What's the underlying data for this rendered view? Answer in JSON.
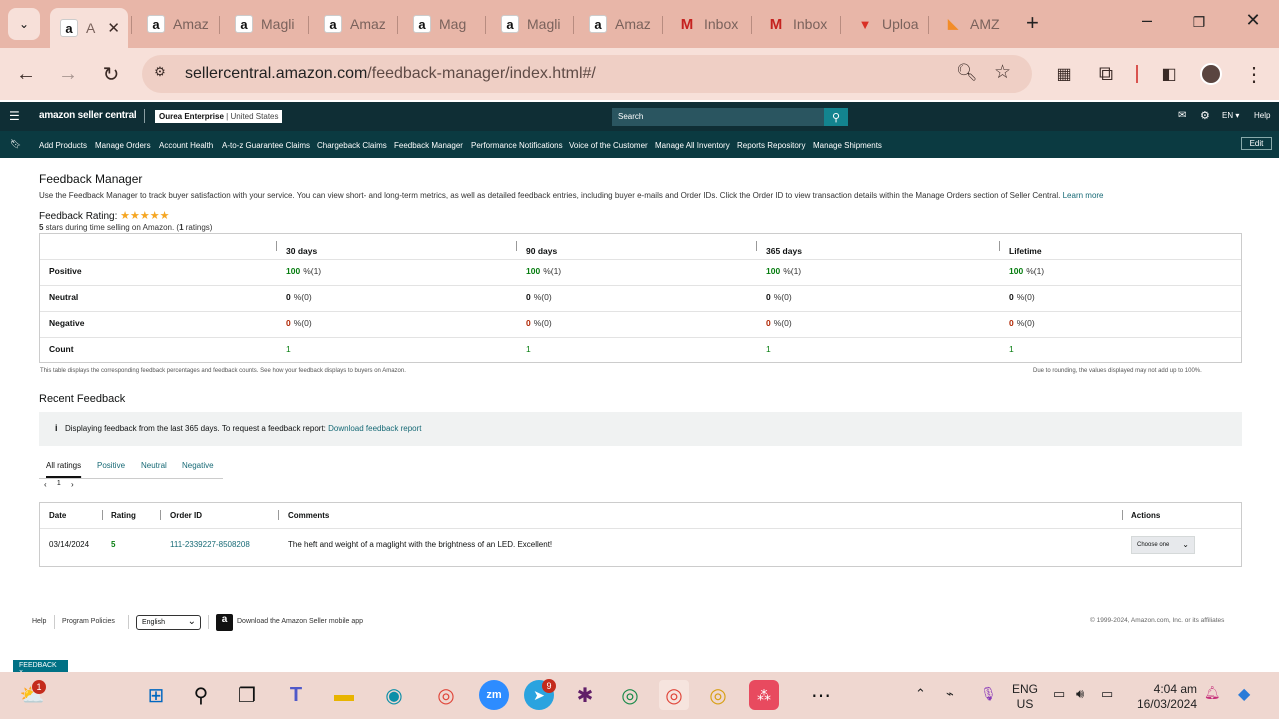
{
  "browser": {
    "tabs": [
      {
        "label": "A",
        "favicon": "amazon-icon",
        "active": true
      },
      {
        "label": "Amaz",
        "favicon": "amazon-icon"
      },
      {
        "label": "Magli",
        "favicon": "amazon-icon"
      },
      {
        "label": "Amaz",
        "favicon": "amazon-icon"
      },
      {
        "label": "Mag",
        "favicon": "amazon-icon"
      },
      {
        "label": "Magli",
        "favicon": "amazon-icon"
      },
      {
        "label": "Amaz",
        "favicon": "amazon-icon"
      },
      {
        "label": "Inbox",
        "favicon": "gmail-icon"
      },
      {
        "label": "Inbox",
        "favicon": "gmail-icon"
      },
      {
        "label": "Uploa",
        "favicon": "upload-icon"
      },
      {
        "label": "AMZ",
        "favicon": "azure-icon"
      }
    ],
    "url_host": "sellercentral.amazon.com",
    "url_path": "/feedback-manager/index.html#/"
  },
  "header": {
    "logo": "amazon seller central",
    "store_name": "Ourea Enterprise",
    "store_region": "| United States",
    "search_placeholder": "Search",
    "lang": "EN",
    "help": "Help"
  },
  "nav": {
    "items": [
      "Add Products",
      "Manage Orders",
      "Account Health",
      "A-to-z Guarantee Claims",
      "Chargeback Claims",
      "Feedback Manager",
      "Performance Notifications",
      "Voice of the Customer",
      "Manage All Inventory",
      "Reports Repository",
      "Manage Shipments"
    ],
    "edit": "Edit"
  },
  "page": {
    "title": "Feedback Manager",
    "intro": "Use the Feedback Manager to track buyer satisfaction with your service. You can view short- and long-term metrics, as well as detailed feedback entries, including buyer e-mails and Order IDs. Click the Order ID to view transaction details within the Manage Orders section of Seller Central.",
    "learn_more": "Learn more",
    "rating_label": "Feedback Rating:",
    "stars": "★★★★★",
    "rating_bold": "5",
    "rating_text_a": " stars during time selling on Amazon. (",
    "rating_count": "1",
    "rating_text_b": " ratings)"
  },
  "rating_table": {
    "columns": [
      "30 days",
      "90 days",
      "365 days",
      "Lifetime"
    ],
    "rows": [
      {
        "label": "Positive",
        "values": [
          [
            "100",
            "%(1)"
          ],
          [
            "100",
            "%(1)"
          ],
          [
            "100",
            "%(1)"
          ],
          [
            "100",
            "%(1)"
          ]
        ]
      },
      {
        "label": "Neutral",
        "values": [
          [
            "0",
            "%(0)"
          ],
          [
            "0",
            "%(0)"
          ],
          [
            "0",
            "%(0)"
          ],
          [
            "0",
            "%(0)"
          ]
        ]
      },
      {
        "label": "Negative",
        "values": [
          [
            "0",
            "%(0)"
          ],
          [
            "0",
            "%(0)"
          ],
          [
            "0",
            "%(0)"
          ],
          [
            "0",
            "%(0)"
          ]
        ]
      },
      {
        "label": "Count",
        "values": [
          [
            "1",
            ""
          ],
          [
            "1",
            ""
          ],
          [
            "1",
            ""
          ],
          [
            "1",
            ""
          ]
        ]
      }
    ],
    "note_left": "This table displays the corresponding feedback percentages and feedback counts. See how your feedback displays to buyers on Amazon.",
    "note_right": "Due to rounding, the values displayed may not add up to 100%."
  },
  "recent": {
    "title": "Recent Feedback",
    "info": "Displaying feedback from the last 365 days. To request a feedback report:",
    "info_link": "Download feedback report",
    "filters": [
      "All ratings",
      "Positive",
      "Neutral",
      "Negative"
    ],
    "page": "1",
    "headers": [
      "Date",
      "Rating",
      "Order ID",
      "Comments",
      "Actions"
    ],
    "row": {
      "date": "03/14/2024",
      "rating": "5",
      "order_id": "111-2339227-8508208",
      "comment": "The heft and weight of a maglight with the brightness of an LED. Excellent!",
      "action": "Choose one"
    }
  },
  "footer": {
    "help": "Help",
    "policies": "Program Policies",
    "language": "English",
    "app": "Download the Amazon Seller mobile app",
    "copyright": "© 1999-2024, Amazon.com, Inc. or its affiliates",
    "feedback_btn": "FEEDBACK ×"
  },
  "taskbar": {
    "weather_badge": "1",
    "telegram_badge": "9",
    "lang1": "ENG",
    "lang2": "US",
    "time": "4:04 am",
    "date": "16/03/2024"
  },
  "colors": {
    "accent": "#067d0f",
    "link": "#176a76",
    "header": "#0f2e35"
  }
}
